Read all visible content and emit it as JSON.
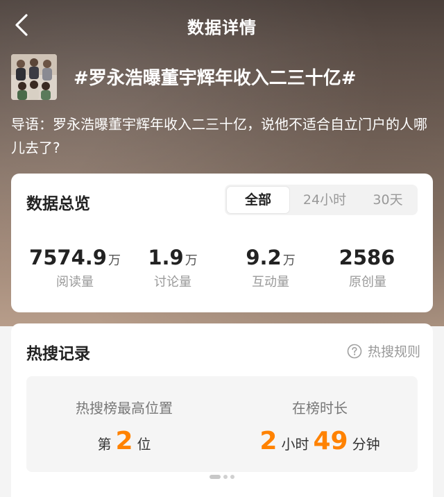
{
  "header": {
    "title": "数据详情",
    "back_icon": "chevron-left-icon"
  },
  "topic": {
    "title": "#罗永浩曝董宇辉年收入二三十亿#",
    "lead": "导语：罗永浩曝董宇辉年收入二三十亿，说他不适合自立门户的人哪儿去了?"
  },
  "overview": {
    "title": "数据总览",
    "tabs": [
      {
        "label": "全部",
        "active": true
      },
      {
        "label": "24小时",
        "active": false
      },
      {
        "label": "30天",
        "active": false
      }
    ],
    "stats": [
      {
        "value": "7574.9",
        "unit": "万",
        "label": "阅读量"
      },
      {
        "value": "1.9",
        "unit": "万",
        "label": "讨论量"
      },
      {
        "value": "9.2",
        "unit": "万",
        "label": "互动量"
      },
      {
        "value": "2586",
        "unit": "",
        "label": "原创量"
      }
    ]
  },
  "hot_search": {
    "title": "热搜记录",
    "rule_label": "热搜规则",
    "rule_icon": "question-circle-icon",
    "highest_position": {
      "label": "热搜榜最高位置",
      "prefix": "第",
      "value": "2",
      "suffix": "位"
    },
    "duration": {
      "label": "在榜时长",
      "hours": "2",
      "hours_unit": "小时",
      "minutes": "49",
      "minutes_unit": "分钟"
    },
    "pager": {
      "pages": 3,
      "current": 1
    }
  },
  "colors": {
    "accent": "#ff8200",
    "text": "#222222",
    "muted": "#999999"
  }
}
